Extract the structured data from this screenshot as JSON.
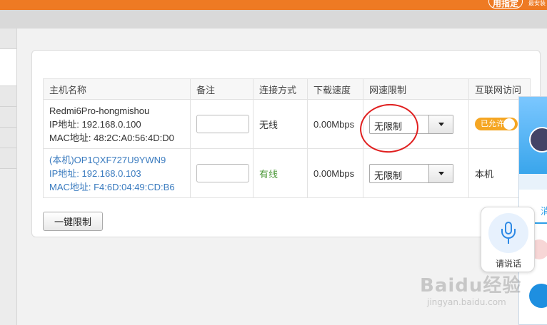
{
  "topbar": {
    "badge_text": "用指定",
    "corner_text": "最安装"
  },
  "table": {
    "headers": [
      "主机名称",
      "备注",
      "连接方式",
      "下载速度",
      "网速限制",
      "互联网访问"
    ],
    "rows": [
      {
        "host_name": "Redmi6Pro-hongmishou",
        "ip": "IP地址: 192.168.0.100",
        "mac": "MAC地址: 48:2C:A0:56:4D:D0",
        "remark": "",
        "connection": "无线",
        "download_speed": "0.00Mbps",
        "speed_limit": "无限制",
        "internet_access": "已允许"
      },
      {
        "host_name": "(本机)OP1QXF727U9YWN9",
        "ip": "IP地址: 192.168.0.103",
        "mac": "MAC地址: F4:6D:04:49:CD:B6",
        "remark": "",
        "connection": "有线",
        "download_speed": "0.00Mbps",
        "speed_limit": "无限制",
        "internet_access": "本机"
      }
    ]
  },
  "one_key_limit_label": "一键限制",
  "qq_panel": {
    "tab_label": "消"
  },
  "voice_widget": {
    "label": "请说话"
  },
  "watermark": {
    "main": "Baidu经验",
    "sub": "jingyan.baidu.com"
  },
  "colors": {
    "topbar": "#ee7a23",
    "link": "#3a7bbf",
    "wired": "#4f9a3c",
    "toggle": "#f5a623",
    "annotation": "#e01f1f"
  }
}
